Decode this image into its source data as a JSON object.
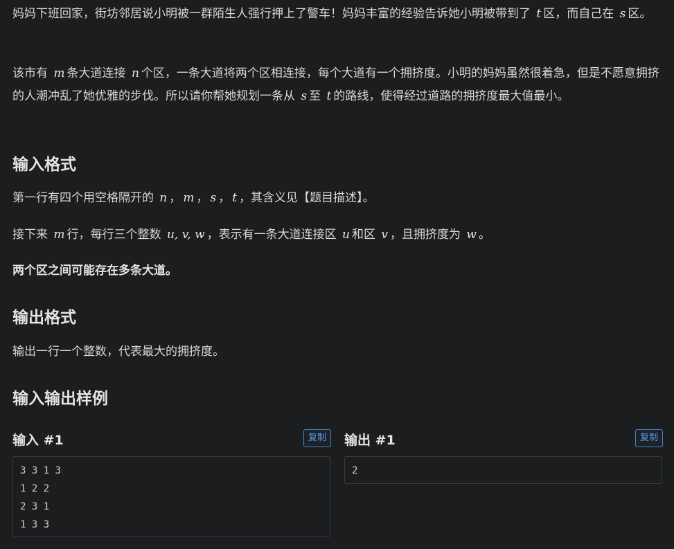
{
  "description": {
    "p1": [
      {
        "t": "妈妈下班回家，街坊邻居说小明被一群陌生人强行押上了警车！妈妈丰富的经验告诉她小明被带到了 "
      },
      {
        "m": "t"
      },
      {
        "t": "区，而自己在 "
      },
      {
        "m": "s"
      },
      {
        "t": "区。"
      }
    ],
    "p2": [
      {
        "t": "该市有 "
      },
      {
        "m": "m"
      },
      {
        "t": "条大道连接 "
      },
      {
        "m": "n"
      },
      {
        "t": "个区，一条大道将两个区相连接，每个大道有一个拥挤度。小明的妈妈虽然很着急，但是不愿意拥挤的人潮冲乱了她优雅的步伐。所以请你帮她规划一条从 "
      },
      {
        "m": "s"
      },
      {
        "t": "至 "
      },
      {
        "m": "t"
      },
      {
        "t": "的路线，使得经过道路的拥挤度最大值最小。"
      }
    ]
  },
  "input_format": {
    "heading": "输入格式",
    "p1": [
      {
        "t": "第一行有四个用空格隔开的 "
      },
      {
        "m": "n"
      },
      {
        "t": "，"
      },
      {
        "m": "m"
      },
      {
        "t": "，"
      },
      {
        "m": "s"
      },
      {
        "t": "，"
      },
      {
        "m": "t"
      },
      {
        "t": "，其含义见【题目描述】。"
      }
    ],
    "p2": [
      {
        "t": "接下来 "
      },
      {
        "m": "m"
      },
      {
        "t": "行，每行三个整数 "
      },
      {
        "m": "u, v, w"
      },
      {
        "t": "，表示有一条大道连接区 "
      },
      {
        "m": "u"
      },
      {
        "t": "和区 "
      },
      {
        "m": "v"
      },
      {
        "t": "，且拥挤度为 "
      },
      {
        "m": "w"
      },
      {
        "t": "。"
      }
    ],
    "note": "两个区之间可能存在多条大道。"
  },
  "output_format": {
    "heading": "输出格式",
    "text": "输出一行一个整数，代表最大的拥挤度。"
  },
  "samples": {
    "heading": "输入输出样例",
    "input": {
      "title": "输入 #1",
      "copy_label": "复制",
      "lines": [
        "3 3 1 3",
        "1 2 2",
        "2 3 1",
        "1 3 3"
      ]
    },
    "output": {
      "title": "输出 #1",
      "copy_label": "复制",
      "lines": [
        "2"
      ]
    }
  }
}
